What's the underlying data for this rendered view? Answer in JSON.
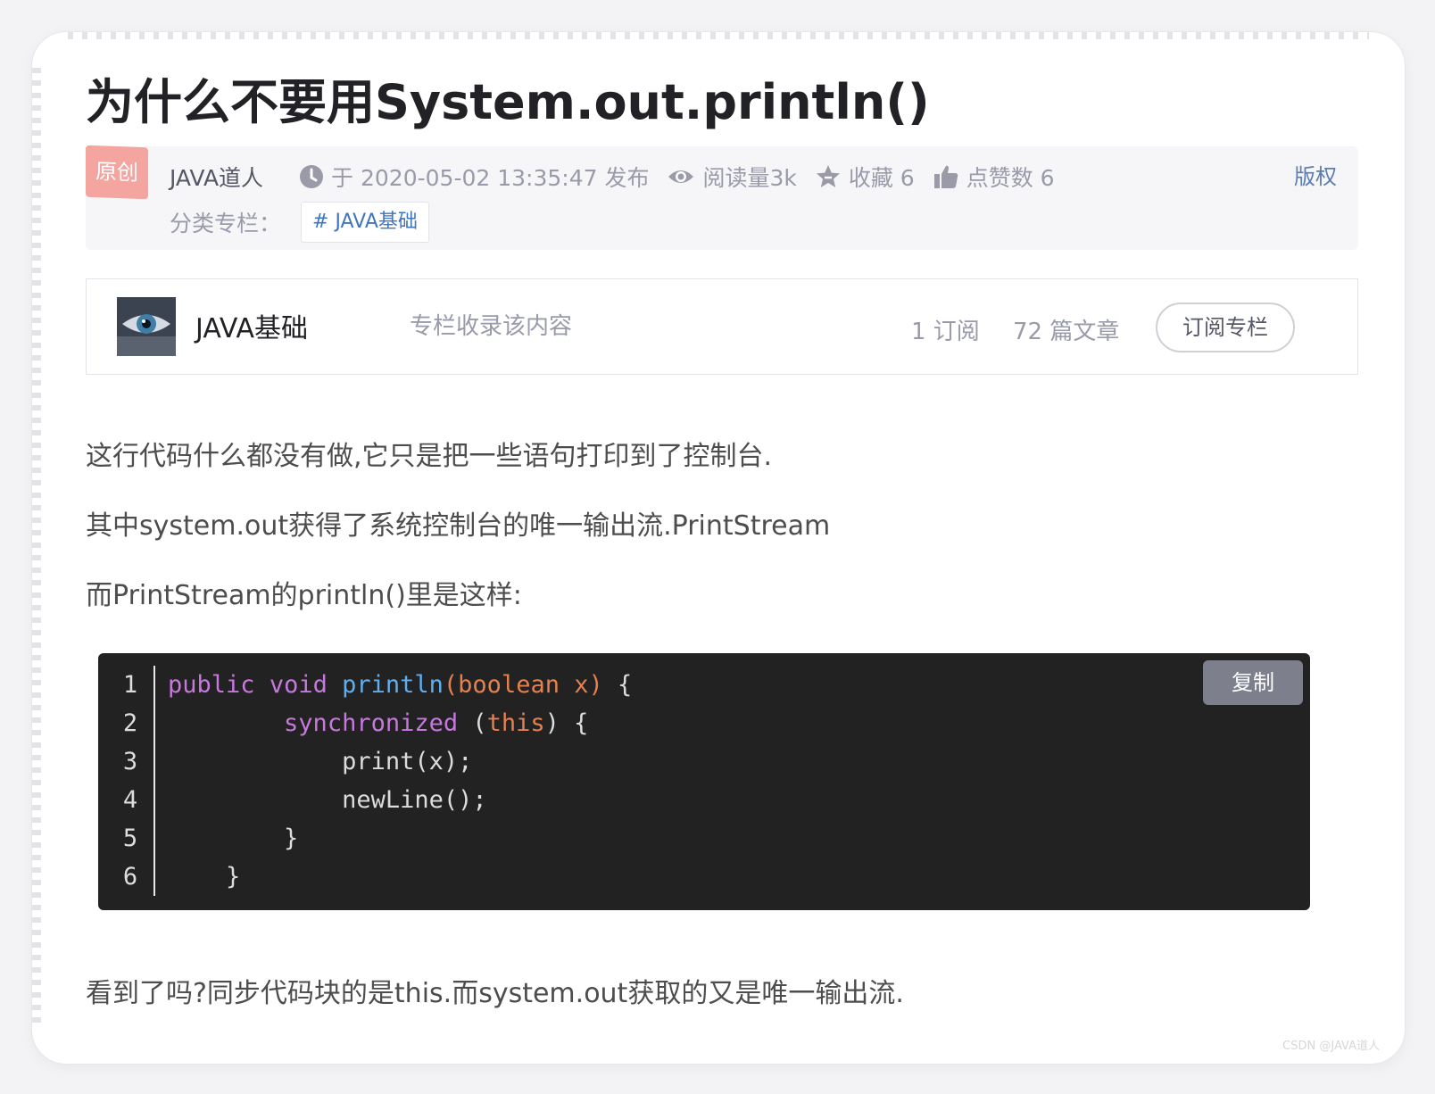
{
  "article": {
    "title": "为什么不要用System.out.println()"
  },
  "meta": {
    "original_badge": "原创",
    "author": "JAVA道人",
    "published": "于 2020-05-02 13:35:47 发布",
    "views": "阅读量3k",
    "favorites": "收藏 6",
    "likes": "点赞数 6",
    "copyright": "版权",
    "category_label": "分类专栏：",
    "category_tag": "# JAVA基础"
  },
  "column": {
    "name": "JAVA基础",
    "description": "专栏收录该内容",
    "subscribers": "1 订阅",
    "articles": "72 篇文章",
    "subscribe_button": "订阅专栏"
  },
  "paragraphs": {
    "p1": "这行代码什么都没有做,它只是把一些语句打印到了控制台.",
    "p2": "其中system.out获得了系统控制台的唯一输出流.PrintStream",
    "p3": "而PrintStream的println()里是这样:",
    "p4": "看到了吗?同步代码块的是this.而system.out获取的又是唯一输出流."
  },
  "code_block": {
    "copy_button": "复制",
    "line_numbers": [
      "1",
      "2",
      "3",
      "4",
      "5",
      "6"
    ],
    "lines": [
      [
        {
          "text": "public",
          "type": "kw"
        },
        {
          "text": " ",
          "type": "plain"
        },
        {
          "text": "void",
          "type": "kw"
        },
        {
          "text": " ",
          "type": "plain"
        },
        {
          "text": "println",
          "type": "fn"
        },
        {
          "text": "(",
          "type": "param"
        },
        {
          "text": "boolean",
          "type": "param"
        },
        {
          "text": " x)",
          "type": "param"
        },
        {
          "text": " {",
          "type": "plain"
        }
      ],
      [
        {
          "text": "        ",
          "type": "plain"
        },
        {
          "text": "synchronized",
          "type": "kw"
        },
        {
          "text": " (",
          "type": "plain"
        },
        {
          "text": "this",
          "type": "param"
        },
        {
          "text": ") {",
          "type": "plain"
        }
      ],
      [
        {
          "text": "            print(x);",
          "type": "plain"
        }
      ],
      [
        {
          "text": "            newLine();",
          "type": "plain"
        }
      ],
      [
        {
          "text": "        }",
          "type": "plain"
        }
      ],
      [
        {
          "text": "    }",
          "type": "plain"
        }
      ]
    ]
  },
  "colors": {
    "keyword": "#c678dd",
    "function": "#61aeee",
    "param": "#e6804f",
    "code_background": "#222222",
    "link": "#3e76c4",
    "badge": "#f4a5a0"
  },
  "watermark": "CSDN @JAVA道人"
}
